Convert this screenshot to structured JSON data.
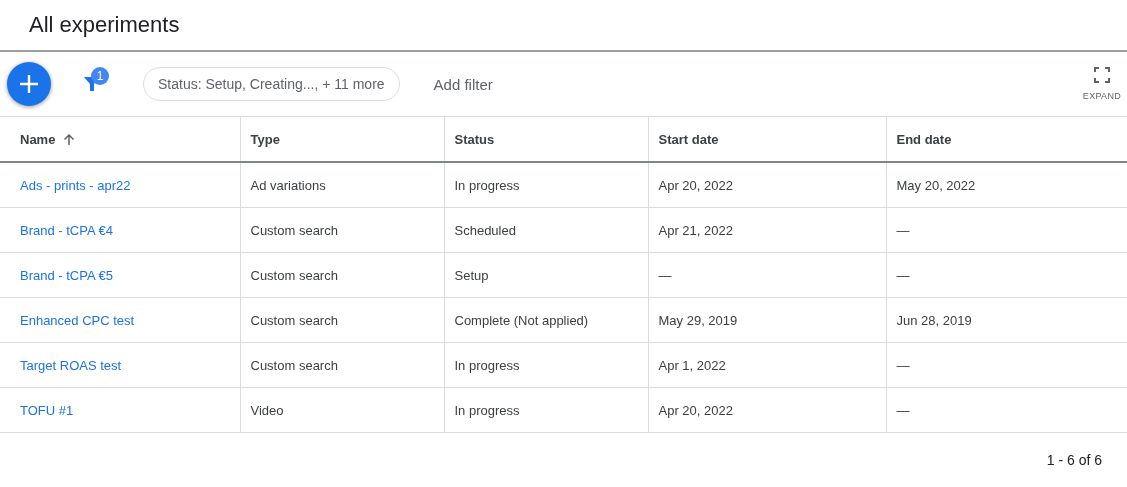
{
  "title": "All experiments",
  "toolbar": {
    "filter_badge": "1",
    "filter_chip": "Status: Setup, Creating..., + 11 more",
    "add_filter": "Add filter",
    "expand_label": "EXPAND"
  },
  "table": {
    "columns": [
      {
        "label": "Name",
        "sorted": true
      },
      {
        "label": "Type",
        "sorted": false
      },
      {
        "label": "Status",
        "sorted": false
      },
      {
        "label": "Start date",
        "sorted": false
      },
      {
        "label": "End date",
        "sorted": false
      }
    ],
    "rows": [
      {
        "name": "Ads - prints - apr22",
        "type": "Ad variations",
        "status": "In progress",
        "start": "Apr 20, 2022",
        "end": "May 20, 2022"
      },
      {
        "name": "Brand - tCPA €4",
        "type": "Custom search",
        "status": "Scheduled",
        "start": "Apr 21, 2022",
        "end": "—"
      },
      {
        "name": "Brand - tCPA €5",
        "type": "Custom search",
        "status": "Setup",
        "start": "—",
        "end": "—"
      },
      {
        "name": "Enhanced CPC test",
        "type": "Custom search",
        "status": "Complete (Not applied)",
        "start": "May 29, 2019",
        "end": "Jun 28, 2019"
      },
      {
        "name": "Target ROAS test",
        "type": "Custom search",
        "status": "In progress",
        "start": "Apr 1, 2022",
        "end": "—"
      },
      {
        "name": "TOFU #1",
        "type": "Video",
        "status": "In progress",
        "start": "Apr 20, 2022",
        "end": "—"
      }
    ]
  },
  "pagination": "1 - 6 of 6"
}
